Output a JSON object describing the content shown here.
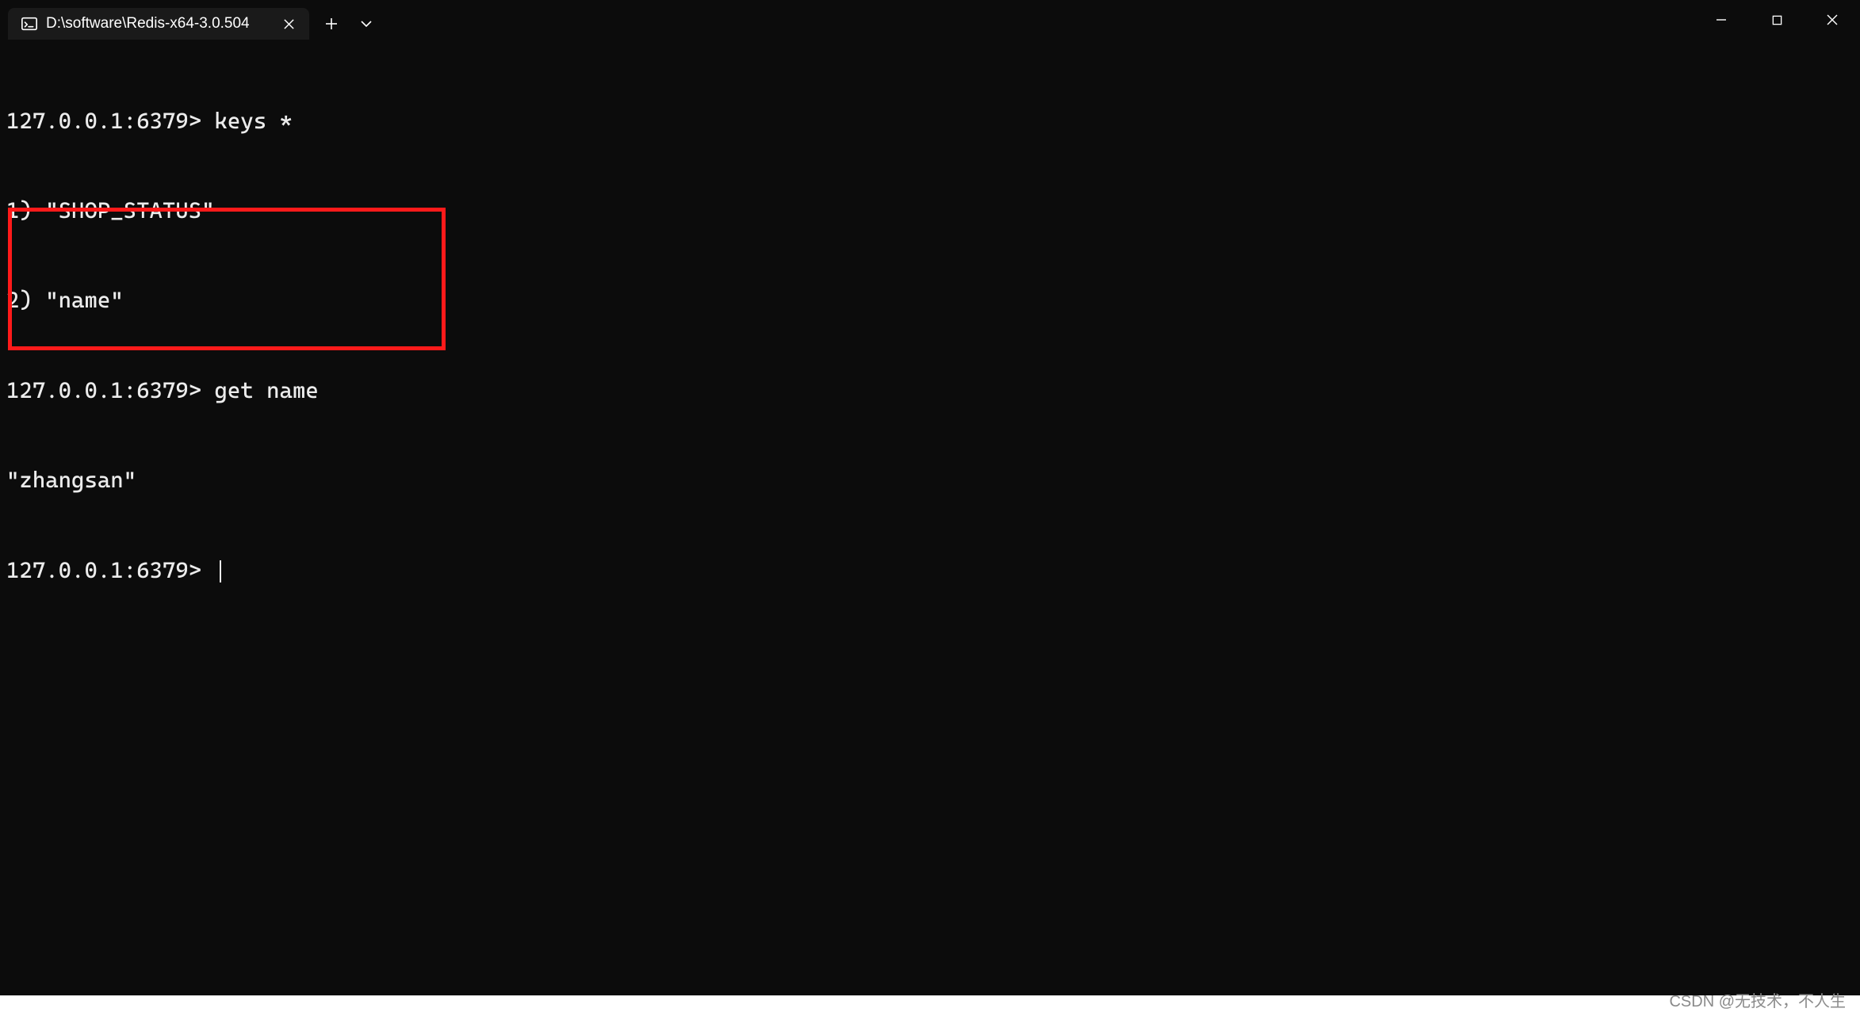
{
  "titlebar": {
    "tab": {
      "title": "D:\\software\\Redis-x64-3.0.504"
    }
  },
  "terminal": {
    "lines": [
      {
        "prompt": "127.0.0.1:6379>",
        "command": "keys *"
      },
      {
        "output": "1) \"SHOP_STATUS\""
      },
      {
        "output": "2) \"name\""
      },
      {
        "prompt": "127.0.0.1:6379>",
        "command": "get name"
      },
      {
        "output": "\"zhangsan\""
      },
      {
        "prompt": "127.0.0.1:6379>",
        "command": ""
      }
    ]
  },
  "watermark": "CSDN @无技术，不人生"
}
